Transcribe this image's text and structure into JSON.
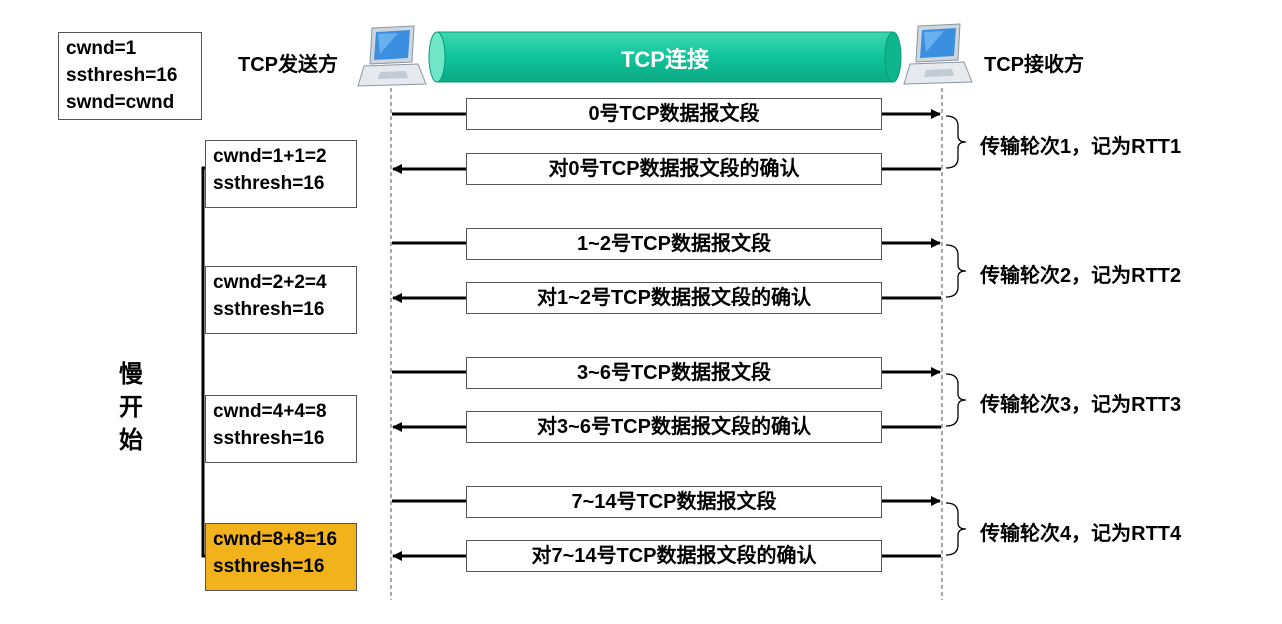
{
  "sender_label": "TCP发送方",
  "receiver_label": "TCP接收方",
  "connection_label": "TCP连接",
  "colors": {
    "connection_fill": "#10c49a",
    "connection_end": "#5ee0c1",
    "highlight_note": "#f2b21c"
  },
  "initial_note": [
    "cwnd=1",
    "ssthresh=16",
    "swnd=cwnd"
  ],
  "phase_label": [
    "慢",
    "开",
    "始"
  ],
  "rounds": [
    {
      "segment": "0号TCP数据报文段",
      "ack": "对0号TCP数据报文段的确认",
      "label": "传输轮次1，记为RTT1",
      "note": [
        "cwnd=1+1=2",
        "ssthresh=16"
      ]
    },
    {
      "segment": "1~2号TCP数据报文段",
      "ack": "对1~2号TCP数据报文段的确认",
      "label": "传输轮次2，记为RTT2",
      "note": [
        "cwnd=2+2=4",
        "ssthresh=16"
      ]
    },
    {
      "segment": "3~6号TCP数据报文段",
      "ack": "对3~6号TCP数据报文段的确认",
      "label": "传输轮次3，记为RTT3",
      "note": [
        "cwnd=4+4=8",
        "ssthresh=16"
      ]
    },
    {
      "segment": "7~14号TCP数据报文段",
      "ack": "对7~14号TCP数据报文段的确认",
      "label": "传输轮次4，记为RTT4",
      "note": [
        "cwnd=8+8=16",
        "ssthresh=16"
      ]
    }
  ]
}
